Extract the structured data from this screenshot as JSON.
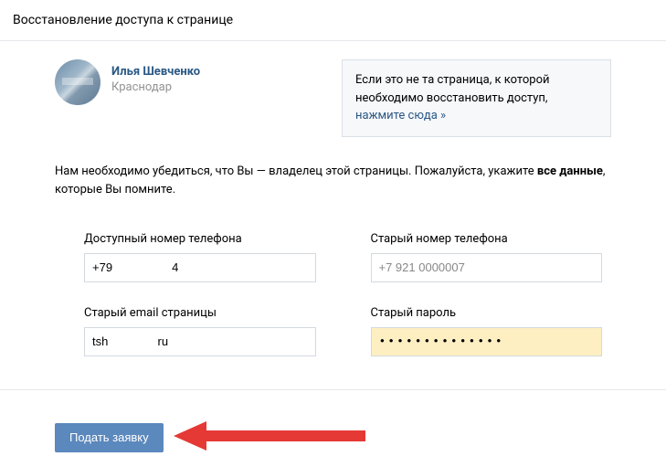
{
  "header": {
    "title": "Восстановление доступа к странице"
  },
  "profile": {
    "name": "Илья Шевченко",
    "location": "Краснодар"
  },
  "notice": {
    "text_before": "Если это не та страница, к которой необходимо восстановить доступ, ",
    "link": "нажмите сюда »"
  },
  "instruction": {
    "before_bold": "Нам необходимо убедиться, что Вы — владелец этой страницы. Пожалуйста, укажите ",
    "bold": "все данные",
    "after_bold": ", которые Вы помните."
  },
  "form": {
    "phone_new": {
      "label": "Доступный номер телефона",
      "value": "+79                  4"
    },
    "phone_old": {
      "label": "Старый номер телефона",
      "placeholder": "+7 921 0000007"
    },
    "email_old": {
      "label": "Старый email страницы",
      "value": "tsh               ru"
    },
    "password_old": {
      "label": "Старый пароль",
      "value": "••••••••••••••"
    }
  },
  "submit": {
    "label": "Подать заявку"
  }
}
